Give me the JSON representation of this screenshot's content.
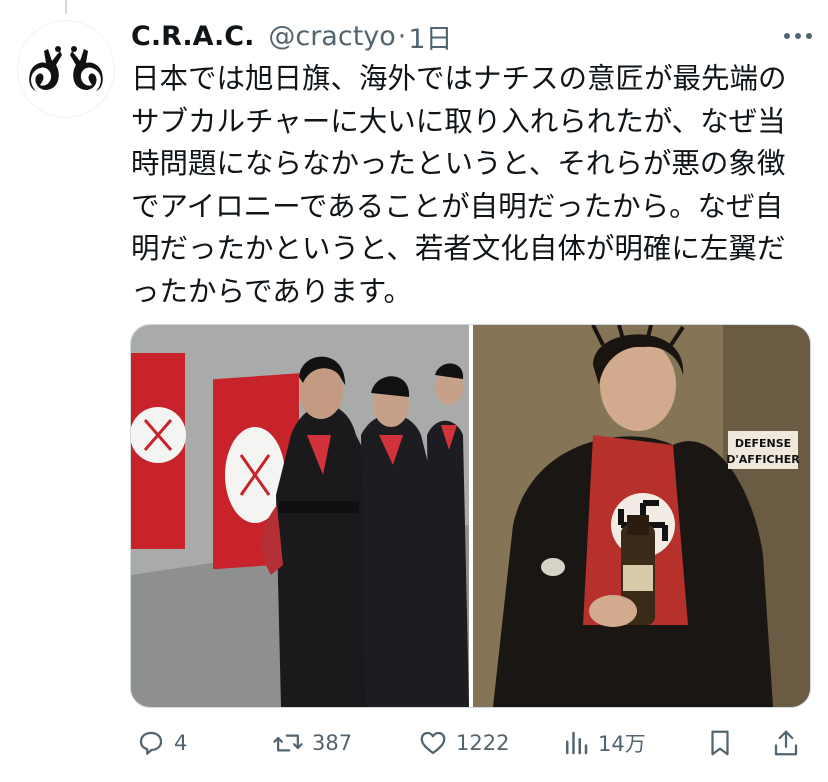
{
  "tweet": {
    "display_name": "C.R.A.C.",
    "handle": "@cractyo",
    "separator": "·",
    "time": "1日",
    "text": "日本では旭日旗、海外ではナチスの意匠が最先端のサブカルチャーに大いに取り入れられたが、なぜ当時問題にならなかったというと、それらが悪の象徴でアイロニーであることが自明だったから。なぜ自明だったかというと、若者文化自体が明確に左翼だったからであります。"
  },
  "media": {
    "right_photo_sign": [
      "DEFENSE",
      "D'AFFICHER"
    ]
  },
  "actions": {
    "reply_count": "4",
    "retweet_count": "387",
    "like_count": "1222",
    "views_count": "14万"
  },
  "colors": {
    "text": "#0f1419",
    "secondary": "#536471",
    "border": "#cfd9de",
    "accent_red": "#c8232b"
  }
}
